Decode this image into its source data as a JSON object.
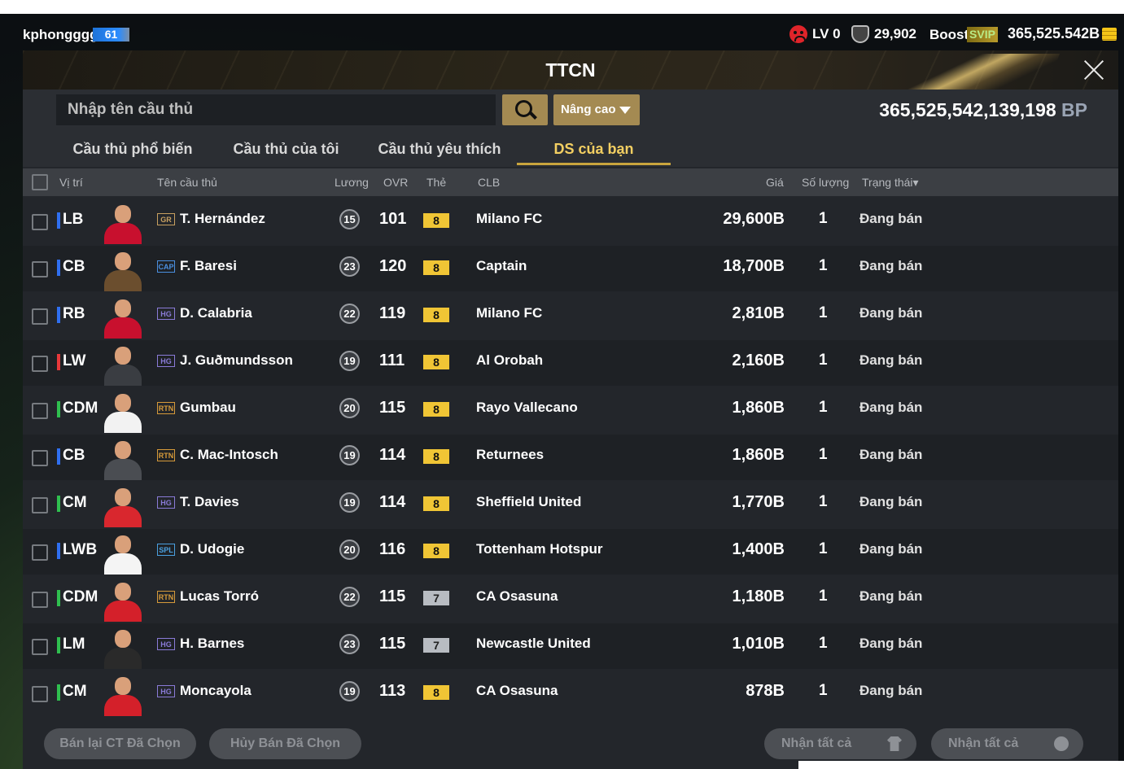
{
  "topbar": {
    "username": "kphongggg",
    "level": "61",
    "lv": "LV 0",
    "trophy_count": "29,902",
    "boost_label": "Boost",
    "svip": "SVIP",
    "balance": "365,525.542B"
  },
  "panel": {
    "title": "TTCN",
    "search_placeholder": "Nhập tên cầu thủ",
    "advanced_label": "Nâng cao",
    "bp_total": "365,525,542,139,198",
    "bp_unit": "BP"
  },
  "tabs": [
    {
      "label": "Cầu thủ phổ biến",
      "active": false
    },
    {
      "label": "Cầu thủ của tôi",
      "active": false
    },
    {
      "label": "Cầu thủ yêu thích",
      "active": false
    },
    {
      "label": "DS của bạn",
      "active": true
    }
  ],
  "columns": {
    "position": "Vị trí",
    "name": "Tên cầu thủ",
    "salary": "Lương",
    "ovr": "OVR",
    "card": "Thẻ",
    "club": "CLB",
    "price": "Giá",
    "qty": "Số lượng",
    "status": "Trạng thái▾"
  },
  "colors": {
    "defender": "#2f6ff0",
    "midfielder": "#2fbf4f",
    "forward": "#e8383a",
    "active_tab": "#f3cf62",
    "button_gold": "#a48a52"
  },
  "rows": [
    {
      "pos": "LB",
      "pos_color": "#2f6ff0",
      "season": "GR",
      "season_color": "#c8a060",
      "name": "T. Hernández",
      "salary": "15",
      "ovr": "101",
      "card": "8",
      "card_type": "gold",
      "club": "Milano FC",
      "price": "29,600B",
      "qty": "1",
      "status": "Đang bán",
      "kit": "#c8102e"
    },
    {
      "pos": "CB",
      "pos_color": "#2f6ff0",
      "season": "CAP",
      "season_color": "#4a8fe0",
      "name": "F. Baresi",
      "salary": "23",
      "ovr": "120",
      "card": "8",
      "card_type": "gold",
      "club": "Captain",
      "price": "18,700B",
      "qty": "1",
      "status": "Đang bán",
      "kit": "#6b4e2e"
    },
    {
      "pos": "RB",
      "pos_color": "#2f6ff0",
      "season": "HG",
      "season_color": "#8a7bd8",
      "name": "D. Calabria",
      "salary": "22",
      "ovr": "119",
      "card": "8",
      "card_type": "gold",
      "club": "Milano FC",
      "price": "2,810B",
      "qty": "1",
      "status": "Đang bán",
      "kit": "#c8102e"
    },
    {
      "pos": "LW",
      "pos_color": "#e8383a",
      "season": "HG",
      "season_color": "#8a7bd8",
      "name": "J. Guðmundsson",
      "salary": "19",
      "ovr": "111",
      "card": "8",
      "card_type": "gold",
      "club": "Al Orobah",
      "price": "2,160B",
      "qty": "1",
      "status": "Đang bán",
      "kit": "#3a3d42"
    },
    {
      "pos": "CDM",
      "pos_color": "#2fbf4f",
      "season": "RTN",
      "season_color": "#d69a3a",
      "name": "Gumbau",
      "salary": "20",
      "ovr": "115",
      "card": "8",
      "card_type": "gold",
      "club": "Rayo Vallecano",
      "price": "1,860B",
      "qty": "1",
      "status": "Đang bán",
      "kit": "#f2f2f2"
    },
    {
      "pos": "CB",
      "pos_color": "#2f6ff0",
      "season": "RTN",
      "season_color": "#d69a3a",
      "name": "C. Mac-Intosch",
      "salary": "19",
      "ovr": "114",
      "card": "8",
      "card_type": "gold",
      "club": "Returnees",
      "price": "1,860B",
      "qty": "1",
      "status": "Đang bán",
      "kit": "#4a4d52"
    },
    {
      "pos": "CM",
      "pos_color": "#2fbf4f",
      "season": "HG",
      "season_color": "#8a7bd8",
      "name": "T. Davies",
      "salary": "19",
      "ovr": "114",
      "card": "8",
      "card_type": "gold",
      "club": "Sheffield United",
      "price": "1,770B",
      "qty": "1",
      "status": "Đang bán",
      "kit": "#d9272e"
    },
    {
      "pos": "LWB",
      "pos_color": "#2f6ff0",
      "season": "SPL",
      "season_color": "#4aa0e0",
      "name": "D. Udogie",
      "salary": "20",
      "ovr": "116",
      "card": "8",
      "card_type": "gold",
      "club": "Tottenham Hotspur",
      "price": "1,400B",
      "qty": "1",
      "status": "Đang bán",
      "kit": "#f4f4f4"
    },
    {
      "pos": "CDM",
      "pos_color": "#2fbf4f",
      "season": "RTN",
      "season_color": "#d69a3a",
      "name": "Lucas Torró",
      "salary": "22",
      "ovr": "115",
      "card": "7",
      "card_type": "silver",
      "club": "CA Osasuna",
      "price": "1,180B",
      "qty": "1",
      "status": "Đang bán",
      "kit": "#d4202a"
    },
    {
      "pos": "LM",
      "pos_color": "#2fbf4f",
      "season": "HG",
      "season_color": "#8a7bd8",
      "name": "H. Barnes",
      "salary": "23",
      "ovr": "115",
      "card": "7",
      "card_type": "silver",
      "club": "Newcastle United",
      "price": "1,010B",
      "qty": "1",
      "status": "Đang bán",
      "kit": "#2a2a2a"
    },
    {
      "pos": "CM",
      "pos_color": "#2fbf4f",
      "season": "HG",
      "season_color": "#8a7bd8",
      "name": "Moncayola",
      "salary": "19",
      "ovr": "113",
      "card": "8",
      "card_type": "gold",
      "club": "CA Osasuna",
      "price": "878B",
      "qty": "1",
      "status": "Đang bán",
      "kit": "#d4202a"
    }
  ],
  "footer": {
    "resell_selected": "Bán lại CT Đã Chọn",
    "cancel_selected": "Hủy Bán Đã Chọn",
    "claim_all_players": "Nhận tất cả",
    "claim_all_bp": "Nhận tất cả"
  }
}
